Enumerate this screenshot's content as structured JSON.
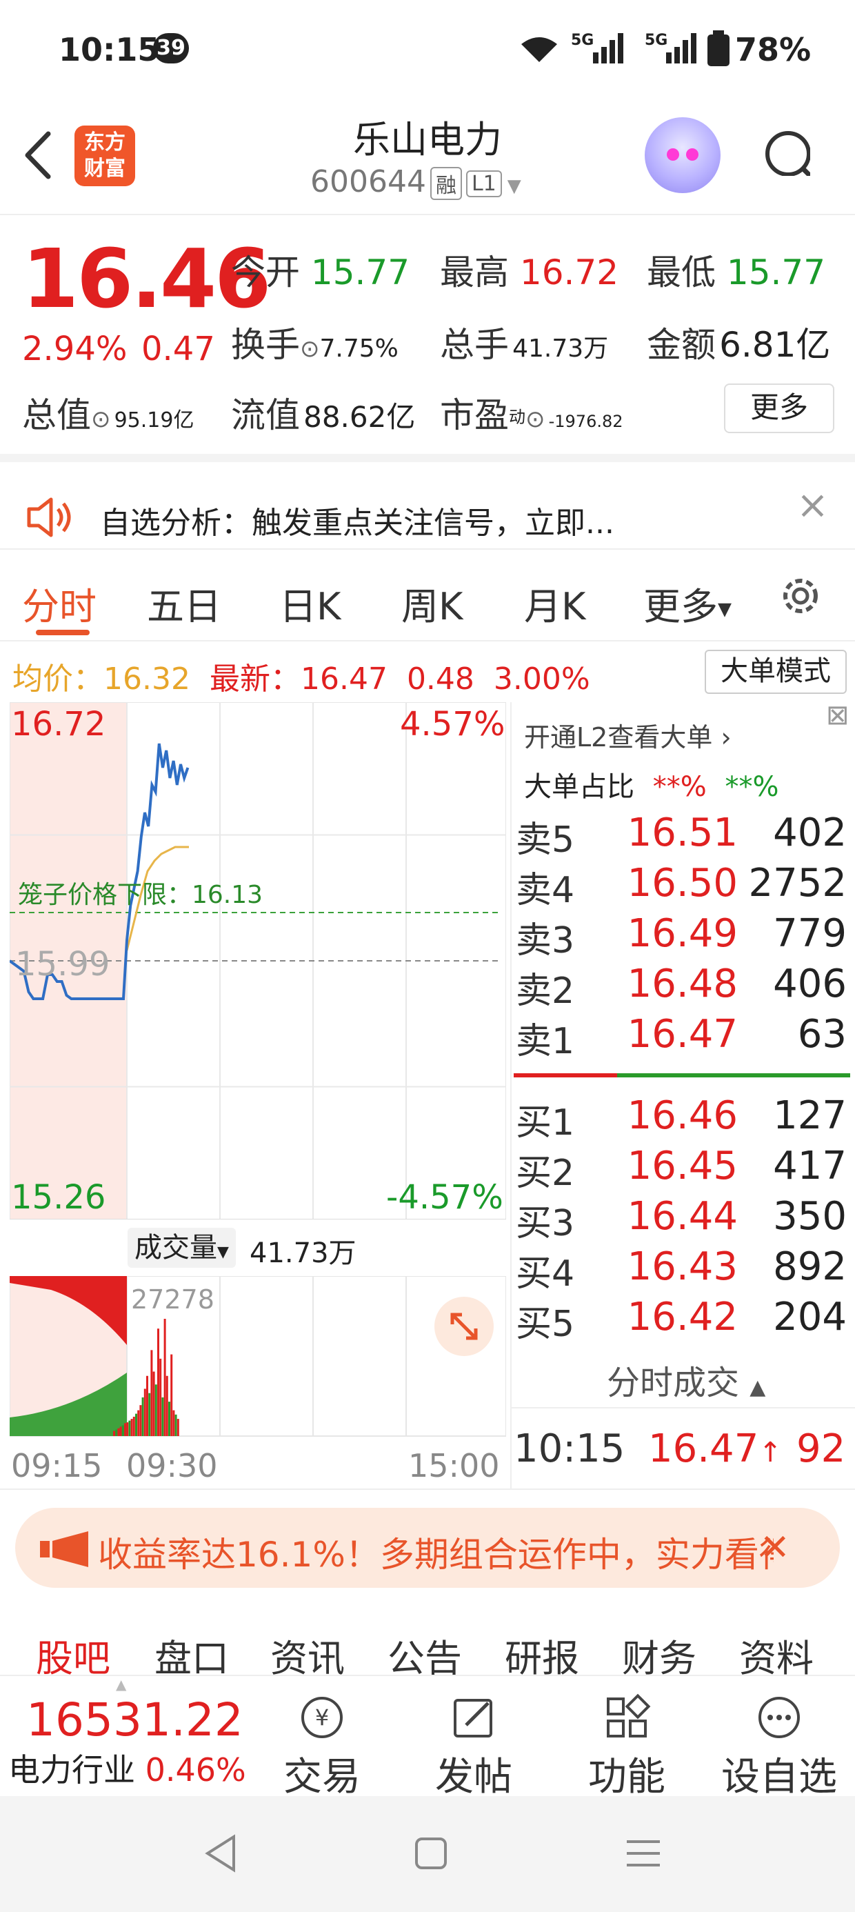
{
  "status_bar": {
    "time": "10:15",
    "badge": "39",
    "network": "5G",
    "battery": "78%"
  },
  "header": {
    "title": "乐山电力",
    "code": "600644",
    "tags": [
      "融",
      "L1"
    ],
    "logo_text_1": "东方",
    "logo_text_2": "财富",
    "back_icon": "chevron-left-icon",
    "search_icon": "search-icon"
  },
  "quote": {
    "price": "16.46",
    "change_pct": "2.94%",
    "change": "0.47",
    "open_label": "今开",
    "open": "15.77",
    "high_label": "最高",
    "high": "16.72",
    "low_label": "最低",
    "low": "15.77",
    "turnover_label": "换手",
    "turnover": "7.75%",
    "volume_label": "总手",
    "volume": "41.73万",
    "amount_label": "金额",
    "amount": "6.81亿",
    "mktcap_label": "总值",
    "mktcap": "95.19亿",
    "float_label": "流值",
    "float": "88.62亿",
    "pe_label": "市盈",
    "pe_sup": "动",
    "pe": "-1976.82",
    "more_button": "更多"
  },
  "notice": {
    "text": "自选分析：触发重点关注信号，立即...",
    "close": "×"
  },
  "chart_tabs": [
    "分时",
    "五日",
    "日K",
    "周K",
    "月K",
    "更多"
  ],
  "info_row": {
    "avg_label": "均价：",
    "avg": "16.32",
    "latest_label": "最新：",
    "latest": "16.47",
    "change": "0.48",
    "change_pct": "3.00%",
    "big_mode": "大单模式"
  },
  "chart_data": {
    "type": "line",
    "y_max_label": "16.72",
    "y_min_label": "15.26",
    "y_mid_label": "15.99",
    "pct_max_label": "4.57%",
    "pct_min_label": "-4.57%",
    "cage_label": "笼子价格下限：16.13",
    "ylim": [
      15.26,
      16.72
    ],
    "prev_close": 15.99,
    "cage_line": 16.13,
    "x_labels": [
      "09:15",
      "09:30",
      "15:00"
    ],
    "price_series": [
      15.99,
      15.98,
      15.97,
      15.96,
      15.9,
      15.88,
      15.88,
      15.88,
      15.95,
      15.95,
      15.93,
      15.93,
      15.89,
      15.88,
      15.88,
      15.88,
      15.88,
      15.88,
      15.88,
      15.88,
      15.88,
      15.88,
      15.88,
      15.88,
      15.88,
      16.05,
      16.15,
      16.2,
      16.25,
      16.35,
      16.42,
      16.38,
      16.5,
      16.48,
      16.62,
      16.55,
      16.6,
      16.52,
      16.57,
      16.5,
      16.56,
      16.52,
      16.55
    ],
    "avg_series": [
      16.02,
      16.1,
      16.18,
      16.25,
      16.28,
      16.3,
      16.31,
      16.32,
      16.32,
      16.32
    ],
    "volume_label": "成交量",
    "volume_total": "41.73万",
    "volume_max_label": "27278",
    "volume_bars": [
      1200,
      1500,
      1800,
      2200,
      2500,
      3000,
      3200,
      3600,
      4000,
      4500,
      5200,
      6000,
      7200,
      9000,
      11000,
      14000,
      10000,
      20000,
      15000,
      12000,
      25000,
      18000,
      9000,
      27278,
      14000,
      8000,
      19000,
      6000,
      5000,
      4000
    ]
  },
  "order_book": {
    "l2_link": "开通L2查看大单",
    "big_ratio_label": "大单占比",
    "big_ratio_1": "**%",
    "big_ratio_2": "**%",
    "asks": [
      {
        "label": "卖5",
        "price": "16.51",
        "vol": "402"
      },
      {
        "label": "卖4",
        "price": "16.50",
        "vol": "2752"
      },
      {
        "label": "卖3",
        "price": "16.49",
        "vol": "779"
      },
      {
        "label": "卖2",
        "price": "16.48",
        "vol": "406"
      },
      {
        "label": "卖1",
        "price": "16.47",
        "vol": "63"
      }
    ],
    "bids": [
      {
        "label": "买1",
        "price": "16.46",
        "vol": "127"
      },
      {
        "label": "买2",
        "price": "16.45",
        "vol": "417"
      },
      {
        "label": "买3",
        "price": "16.44",
        "vol": "350"
      },
      {
        "label": "买4",
        "price": "16.43",
        "vol": "892"
      },
      {
        "label": "买5",
        "price": "16.42",
        "vol": "204"
      }
    ],
    "trades_label": "分时成交",
    "trade": {
      "time": "10:15",
      "price": "16.47",
      "arrow": "↑",
      "vol": "92"
    }
  },
  "banner": {
    "text": "收益率达16.1%！多期组合运作中，实力看得",
    "close": "✕"
  },
  "bottom_tabs": [
    "股吧",
    "盘口",
    "资讯",
    "公告",
    "研报",
    "财务",
    "资料"
  ],
  "bottom_bar": {
    "index_value": "16531.22",
    "index_name": "电力行业",
    "index_pct": "0.46%",
    "trade": "交易",
    "post": "发帖",
    "function": "功能",
    "watch": "设自选"
  }
}
